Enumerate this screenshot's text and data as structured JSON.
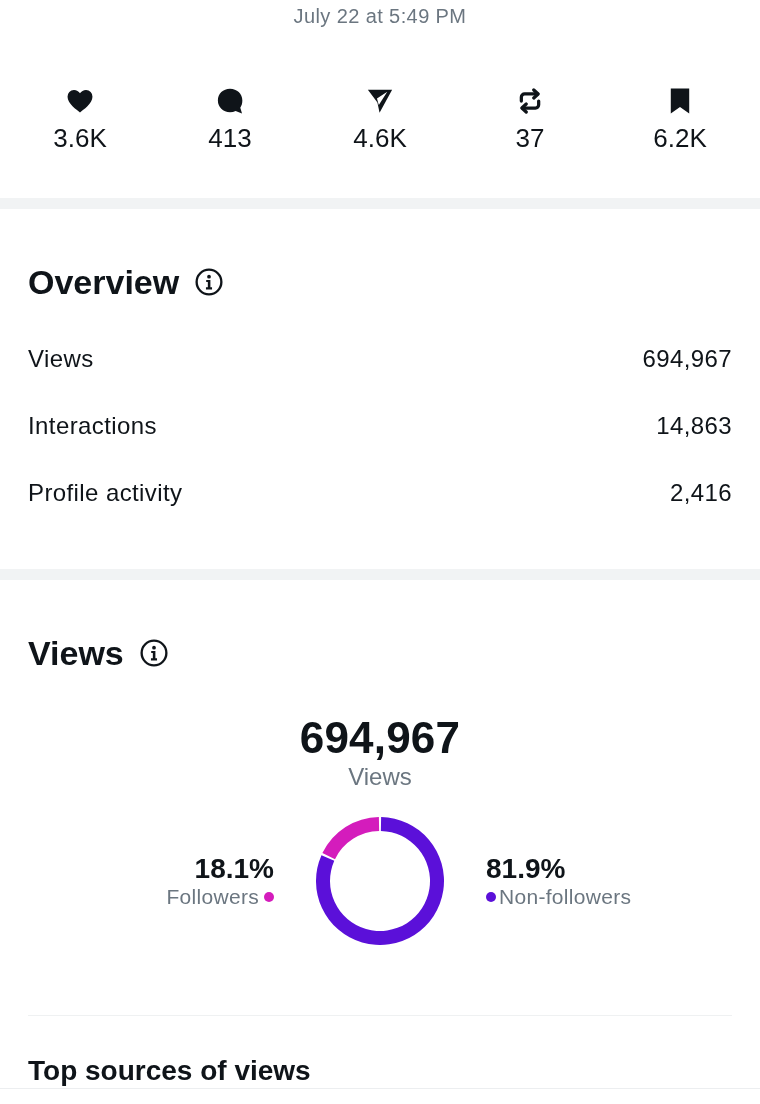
{
  "timestamp": "July 22 at 5:49 PM",
  "engagement": [
    {
      "kind": "likes",
      "count": "3.6K"
    },
    {
      "kind": "replies",
      "count": "413"
    },
    {
      "kind": "shares",
      "count": "4.6K"
    },
    {
      "kind": "reposts",
      "count": "37"
    },
    {
      "kind": "bookmarks",
      "count": "6.2K"
    }
  ],
  "overview": {
    "title": "Overview",
    "rows": [
      {
        "label": "Views",
        "value": "694,967"
      },
      {
        "label": "Interactions",
        "value": "14,863"
      },
      {
        "label": "Profile activity",
        "value": "2,416"
      }
    ]
  },
  "views": {
    "title": "Views",
    "total": "694,967",
    "total_label": "Views",
    "legend": [
      {
        "percent": "18.1%",
        "color": "#d41cbc"
      },
      {
        "percent": "81.9%",
        "color": "#5b10d9"
      }
    ],
    "chart_data": {
      "type": "donut",
      "categories": [
        "Followers",
        "Non-followers"
      ],
      "values": [
        18.1,
        81.9
      ]
    }
  },
  "next_section": {
    "title": "Top sources of views"
  }
}
